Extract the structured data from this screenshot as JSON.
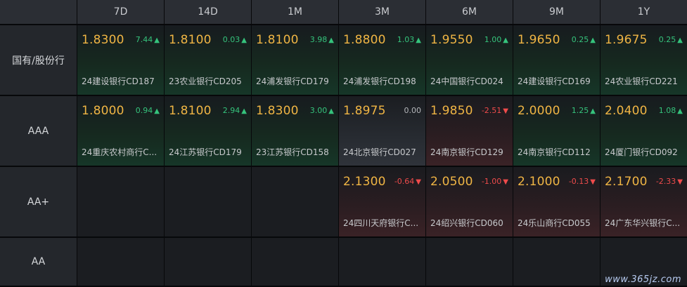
{
  "columns": [
    "7D",
    "14D",
    "1M",
    "3M",
    "6M",
    "9M",
    "1Y"
  ],
  "rows": [
    {
      "label": "国有/股份行",
      "cells": [
        {
          "rate": "1.8300",
          "change": "7.44",
          "arrow": "▲",
          "trend": "up",
          "name": "24建设银行CD187"
        },
        {
          "rate": "1.8100",
          "change": "0.03",
          "arrow": "▲",
          "trend": "up",
          "name": "23农业银行CD205"
        },
        {
          "rate": "1.8100",
          "change": "3.98",
          "arrow": "▲",
          "trend": "up",
          "name": "24浦发银行CD179"
        },
        {
          "rate": "1.8800",
          "change": "1.03",
          "arrow": "▲",
          "trend": "up",
          "name": "24浦发银行CD198"
        },
        {
          "rate": "1.9550",
          "change": "1.00",
          "arrow": "▲",
          "trend": "up",
          "name": "24中国银行CD024"
        },
        {
          "rate": "1.9650",
          "change": "0.25",
          "arrow": "▲",
          "trend": "up",
          "name": "24建设银行CD169"
        },
        {
          "rate": "1.9675",
          "change": "0.25",
          "arrow": "▲",
          "trend": "up",
          "name": "24农业银行CD221"
        }
      ]
    },
    {
      "label": "AAA",
      "cells": [
        {
          "rate": "1.8000",
          "change": "0.94",
          "arrow": "▲",
          "trend": "up",
          "name": "24重庆农村商行C..."
        },
        {
          "rate": "1.8100",
          "change": "2.94",
          "arrow": "▲",
          "trend": "up",
          "name": "24江苏银行CD179"
        },
        {
          "rate": "1.8300",
          "change": "3.00",
          "arrow": "▲",
          "trend": "up",
          "name": "23江苏银行CD158"
        },
        {
          "rate": "1.8975",
          "change": "0.00",
          "arrow": "",
          "trend": "flat",
          "name": "24北京银行CD027"
        },
        {
          "rate": "1.9850",
          "change": "-2.51",
          "arrow": "▼",
          "trend": "down",
          "name": "24南京银行CD129"
        },
        {
          "rate": "2.0000",
          "change": "1.25",
          "arrow": "▲",
          "trend": "up",
          "name": "24南京银行CD112"
        },
        {
          "rate": "2.0400",
          "change": "1.08",
          "arrow": "▲",
          "trend": "up",
          "name": "24厦门银行CD092"
        }
      ]
    },
    {
      "label": "AA+",
      "cells": [
        null,
        null,
        null,
        {
          "rate": "2.1300",
          "change": "-0.64",
          "arrow": "▼",
          "trend": "down",
          "name": "24四川天府银行C..."
        },
        {
          "rate": "2.0500",
          "change": "-1.00",
          "arrow": "▼",
          "trend": "down",
          "name": "24绍兴银行CD060"
        },
        {
          "rate": "2.1000",
          "change": "-0.13",
          "arrow": "▼",
          "trend": "down",
          "name": "24乐山商行CD055"
        },
        {
          "rate": "2.1700",
          "change": "-2.33",
          "arrow": "▼",
          "trend": "down",
          "name": "24广东华兴银行C..."
        }
      ]
    },
    {
      "label": "AA",
      "cells": [
        null,
        null,
        null,
        null,
        null,
        null,
        null
      ]
    }
  ],
  "watermark": "www.365jz.com",
  "colors": {
    "rate": "#f0b544",
    "up": "#35c37c",
    "down": "#ef4b4b",
    "flat": "#b4b6ba"
  }
}
